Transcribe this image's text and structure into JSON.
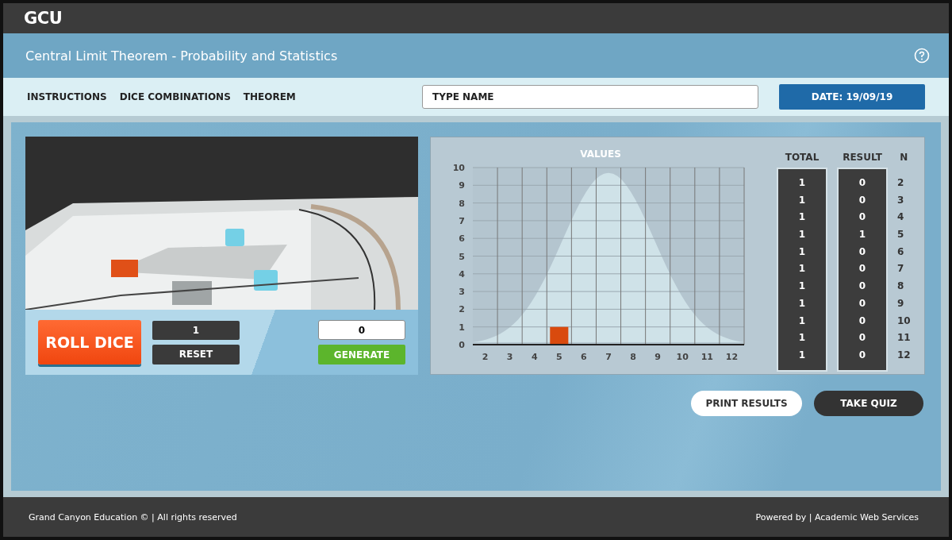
{
  "brand": {
    "logo": "GCU"
  },
  "header": {
    "title": "Central Limit Theorem - Probability and Statistics"
  },
  "nav": {
    "links": [
      "INSTRUCTIONS",
      "DICE COMBINATIONS",
      "THEOREM"
    ],
    "name_field": {
      "placeholder": "TYPE NAME"
    },
    "date_button": "DATE: 19/09/19"
  },
  "game": {
    "roll_button": "ROLL DICE",
    "roll_count": "1",
    "reset_button": "RESET",
    "generate_field": "0",
    "generate_button": "GENERATE"
  },
  "results": {
    "chart_data": {
      "type": "bar",
      "title": "VALUES",
      "categories": [
        "2",
        "3",
        "4",
        "5",
        "6",
        "7",
        "8",
        "9",
        "10",
        "11",
        "12"
      ],
      "grid": true,
      "series": [
        {
          "color": "#d94a0e",
          "values": [
            0,
            0,
            0,
            1,
            0,
            0,
            0,
            0,
            0,
            0,
            0
          ]
        }
      ],
      "ylim": [
        0,
        10
      ],
      "yticks": [
        0,
        1,
        2,
        3,
        4,
        5,
        6,
        7,
        8,
        9,
        10
      ]
    },
    "table": {
      "columns": [
        "TOTAL",
        "RESULT",
        "N"
      ],
      "rows": [
        {
          "total": "1",
          "result": "0",
          "n": "2"
        },
        {
          "total": "1",
          "result": "0",
          "n": "3"
        },
        {
          "total": "1",
          "result": "0",
          "n": "4"
        },
        {
          "total": "1",
          "result": "1",
          "n": "5"
        },
        {
          "total": "1",
          "result": "0",
          "n": "6"
        },
        {
          "total": "1",
          "result": "0",
          "n": "7"
        },
        {
          "total": "1",
          "result": "0",
          "n": "8"
        },
        {
          "total": "1",
          "result": "0",
          "n": "9"
        },
        {
          "total": "1",
          "result": "0",
          "n": "10"
        },
        {
          "total": "1",
          "result": "0",
          "n": "11"
        },
        {
          "total": "1",
          "result": "0",
          "n": "12"
        }
      ]
    }
  },
  "actions": {
    "print_button": "PRINT RESULTS",
    "quiz_button": "TAKE QUIZ"
  },
  "footer": {
    "left": "Grand Canyon Education © | All rights reserved",
    "right": "Powered by | Academic Web Services"
  }
}
